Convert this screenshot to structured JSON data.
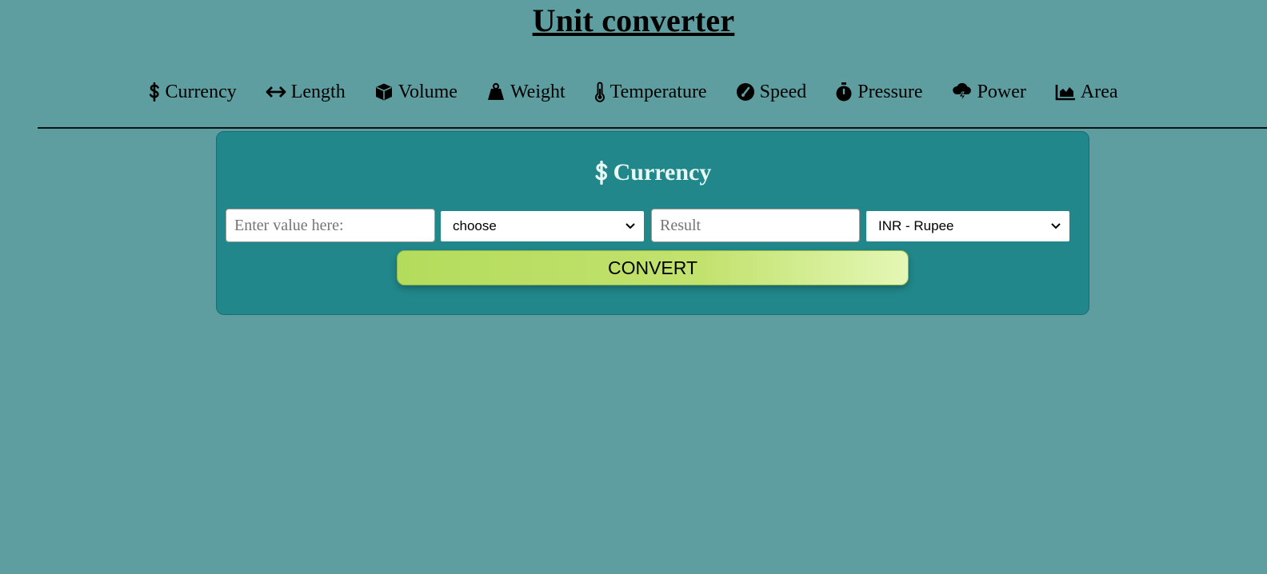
{
  "page": {
    "title": "Unit converter"
  },
  "nav": {
    "items": [
      {
        "label": "Currency",
        "icon": "dollar-icon"
      },
      {
        "label": "Length",
        "icon": "arrows-horizontal-icon"
      },
      {
        "label": "Volume",
        "icon": "cube-icon"
      },
      {
        "label": "Weight",
        "icon": "weight-icon"
      },
      {
        "label": "Temperature",
        "icon": "thermometer-icon"
      },
      {
        "label": "Speed",
        "icon": "gauge-icon"
      },
      {
        "label": "Pressure",
        "icon": "stopwatch-icon"
      },
      {
        "label": "Power",
        "icon": "cloud-bolt-icon"
      },
      {
        "label": "Area",
        "icon": "area-chart-icon"
      }
    ]
  },
  "converter": {
    "title": "Currency",
    "title_icon": "dollar-icon",
    "input": {
      "value": "",
      "placeholder": "Enter value here:"
    },
    "from_select": {
      "selected": "choose"
    },
    "result": {
      "value": "",
      "placeholder": "Result"
    },
    "to_select": {
      "selected": "INR - Rupee"
    },
    "convert_label": "CONVERT"
  },
  "colors": {
    "background": "#5f9ea0",
    "panel": "#21878a",
    "panel_title": "#e6f9f6",
    "button_start": "#b4dc5c",
    "button_end": "#e4f7b5"
  }
}
